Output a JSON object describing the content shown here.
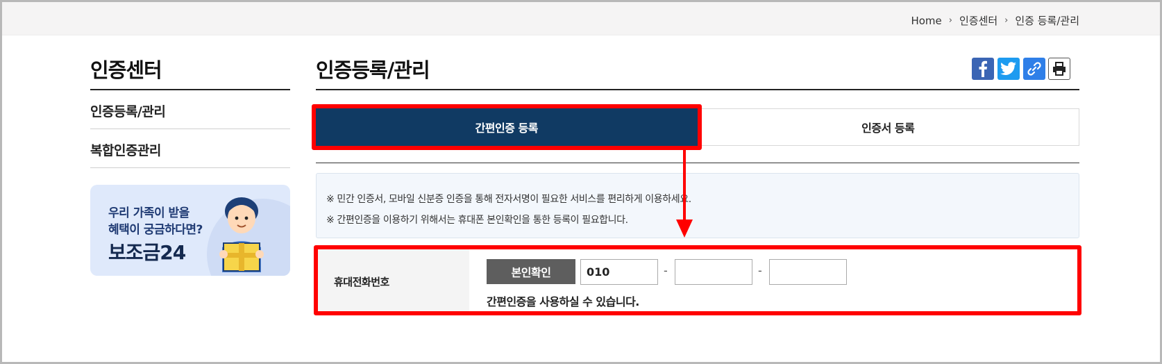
{
  "breadcrumb": [
    "Home",
    "인증센터",
    "인증 등록/관리"
  ],
  "sidebar": {
    "title": "인증센터",
    "items": [
      {
        "label": "인증등록/관리"
      },
      {
        "label": "복합인증관리"
      }
    ],
    "banner": {
      "line1": "우리 가족이 받을",
      "line2": "혜택이 궁금하다면?",
      "title": "보조금24"
    }
  },
  "main": {
    "title": "인증등록/관리",
    "share_icons": [
      "facebook-icon",
      "twitter-icon",
      "link-icon",
      "print-icon"
    ],
    "tabs": [
      {
        "label": "간편인증 등록",
        "active": true
      },
      {
        "label": "인증서 등록",
        "active": false
      }
    ],
    "notice": [
      "※ 민간 인증서, 모바일 신분증 인증을 통해 전자서명이 필요한 서비스를 편리하게 이용하세요.",
      "※ 간편인증을 이용하기 위해서는 휴대폰 본인확인을 통한 등록이 필요합니다."
    ],
    "form": {
      "label": "휴대전화번호",
      "verify_button": "본인확인",
      "phone_first": "010",
      "phone_middle": "",
      "phone_last": "",
      "dash": "-",
      "message": "간편인증을 사용하실 수 있습니다."
    }
  },
  "colors": {
    "active_tab": "#103a63",
    "annotation": "#ff0000",
    "verify_button": "#5e5e5e"
  }
}
